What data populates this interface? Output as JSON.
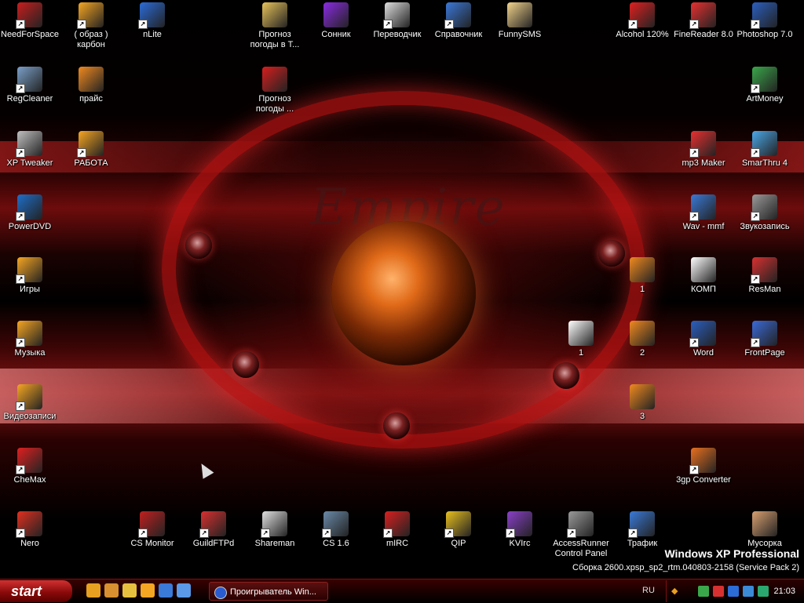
{
  "desktop": {
    "wallpaper_text": "Empire",
    "icons": [
      {
        "label": "NeedForSpace",
        "icon": "santa-hat-icon",
        "color": "#c81e1e",
        "shortcut": true
      },
      {
        "label": "( образ ) карбон",
        "icon": "chevron-icon",
        "color": "#f5a623",
        "shortcut": true
      },
      {
        "label": "nLite",
        "icon": "nlite-icon",
        "color": "#2b6cd8",
        "shortcut": true
      },
      {
        "label": "Прогноз погоды в Т...",
        "icon": "folder-icon",
        "color": "#e8c35a",
        "shortcut": false
      },
      {
        "label": "Сонник",
        "icon": "purple-diamond-icon",
        "color": "#8a2be2",
        "shortcut": false
      },
      {
        "label": "Переводчик",
        "icon": "stopwatch-icon",
        "color": "#dddddd",
        "shortcut": true
      },
      {
        "label": "Справочник",
        "icon": "stacked-pages-icon",
        "color": "#3a78d8",
        "shortcut": true
      },
      {
        "label": "FunnySMS",
        "icon": "envelope-icon",
        "color": "#f2d38a",
        "shortcut": false
      },
      {
        "label": "Alcohol 120%",
        "icon": "alcohol-icon",
        "color": "#e02020",
        "shortcut": true
      },
      {
        "label": "FineReader 8.0",
        "icon": "finereader-icon",
        "color": "#e83030",
        "shortcut": true
      },
      {
        "label": "Photoshop 7.0",
        "icon": "photoshop-icon",
        "color": "#2b5fbf",
        "shortcut": true
      },
      {
        "label": "RegCleaner",
        "icon": "regcleaner-icon",
        "color": "#7aa0c8",
        "shortcut": true
      },
      {
        "label": "прайс",
        "icon": "document-icon",
        "color": "#f08a20",
        "shortcut": false
      },
      {
        "label": "Прогноз погоды ...",
        "icon": "opera-document-icon",
        "color": "#d81e1e",
        "shortcut": false
      },
      {
        "label": "ArtMoney",
        "icon": "money-icon",
        "color": "#3aa84a",
        "shortcut": true
      },
      {
        "label": "XP Tweaker",
        "icon": "tools-icon",
        "color": "#c0c0c0",
        "shortcut": true
      },
      {
        "label": "РАБОТА",
        "icon": "chevron-icon",
        "color": "#f5a623",
        "shortcut": true
      },
      {
        "label": "mp3 Maker",
        "icon": "mp3-maker-icon",
        "color": "#e83030",
        "shortcut": true
      },
      {
        "label": "SmarThru 4",
        "icon": "smarthru-icon",
        "color": "#4aa8e8",
        "shortcut": true
      },
      {
        "label": "PowerDVD",
        "icon": "powerdvd-icon",
        "color": "#1e6ec8",
        "shortcut": true
      },
      {
        "label": "Wav - mmf",
        "icon": "wav-mmf-icon",
        "color": "#3a7ad8",
        "shortcut": true
      },
      {
        "label": "Звукозапись",
        "icon": "speaker-icon",
        "color": "#9a9a9a",
        "shortcut": true
      },
      {
        "label": "Игры",
        "icon": "chevron-icon",
        "color": "#f5a623",
        "shortcut": true
      },
      {
        "label": "1",
        "icon": "document-icon",
        "color": "#f08a20",
        "shortcut": false
      },
      {
        "label": "КОМП",
        "icon": "text-document-icon",
        "color": "#ffffff",
        "shortcut": false
      },
      {
        "label": "ResMan",
        "icon": "resman-icon",
        "color": "#d83030",
        "shortcut": true
      },
      {
        "label": "Музыка",
        "icon": "music-icon",
        "color": "#f5a623",
        "shortcut": true
      },
      {
        "label": "1",
        "icon": "text-document-icon",
        "color": "#ffffff",
        "shortcut": false
      },
      {
        "label": "2",
        "icon": "document-icon",
        "color": "#f08a20",
        "shortcut": false
      },
      {
        "label": "Word",
        "icon": "word-icon",
        "color": "#2b5fbf",
        "shortcut": true
      },
      {
        "label": "FrontPage",
        "icon": "frontpage-icon",
        "color": "#3a6ad8",
        "shortcut": true
      },
      {
        "label": "Видеозаписи",
        "icon": "video-icon",
        "color": "#f5a623",
        "shortcut": true
      },
      {
        "label": "3",
        "icon": "document-icon",
        "color": "#f08a20",
        "shortcut": false
      },
      {
        "label": "CheMax",
        "icon": "red-x-icon",
        "color": "#e02020",
        "shortcut": true
      },
      {
        "label": "3gp Converter",
        "icon": "3gp-converter-icon",
        "color": "#e87020",
        "shortcut": true
      },
      {
        "label": "Nero",
        "icon": "nero-icon",
        "color": "#e03020",
        "shortcut": true
      },
      {
        "label": "CS Monitor",
        "icon": "cs-monitor-icon",
        "color": "#c02020",
        "shortcut": true
      },
      {
        "label": "GuildFTPd",
        "icon": "guildftpd-icon",
        "color": "#d83030",
        "shortcut": true
      },
      {
        "label": "Shareman",
        "icon": "shareman-icon",
        "color": "#e0e0e0",
        "shortcut": true
      },
      {
        "label": "CS 1.6",
        "icon": "cs16-icon",
        "color": "#6a8aa8",
        "shortcut": true
      },
      {
        "label": "mIRC",
        "icon": "mirc-icon",
        "color": "#d82020",
        "shortcut": true
      },
      {
        "label": "QIP",
        "icon": "qip-icon",
        "color": "#e8c020",
        "shortcut": true
      },
      {
        "label": "KVIrc",
        "icon": "kvirc-icon",
        "color": "#8a40c8",
        "shortcut": true
      },
      {
        "label": "AccessRunner Control Panel",
        "icon": "modem-icon",
        "color": "#9a9a9a",
        "shortcut": true
      },
      {
        "label": "Трафик",
        "icon": "network-icon",
        "color": "#3a7ad8",
        "shortcut": true
      },
      {
        "label": "Мусорка",
        "icon": "recycle-bin-icon",
        "color": "#d8a070",
        "shortcut": false
      }
    ]
  },
  "os_info": {
    "edition": "Windows XP Professional",
    "build": "Сборка 2600.xpsp_sp2_rtm.040803-2158 (Service Pack 2)"
  },
  "taskbar": {
    "start_label": "start",
    "quick_launch": [
      {
        "icon": "firefox-icon",
        "color": "#e8a020"
      },
      {
        "icon": "user-icon",
        "color": "#d89030"
      },
      {
        "icon": "disc-icon",
        "color": "#e8c040"
      },
      {
        "icon": "bird-icon",
        "color": "#f5a623"
      },
      {
        "icon": "browser-icon",
        "color": "#3a7ad8"
      },
      {
        "icon": "window-icon",
        "color": "#5a9ae8"
      }
    ],
    "task_label": "Проигрыватель Win...",
    "language": "RU",
    "tray": [
      {
        "icon": "network-tray-icon",
        "color": "#3aa84a"
      },
      {
        "icon": "security-tray-icon",
        "color": "#d83030"
      },
      {
        "icon": "help-tray-icon",
        "color": "#2b6cd8"
      },
      {
        "icon": "volume-tray-icon",
        "color": "#3a8ad8"
      },
      {
        "icon": "shield-tray-icon",
        "color": "#2aa870"
      }
    ],
    "clock": "21:03"
  }
}
